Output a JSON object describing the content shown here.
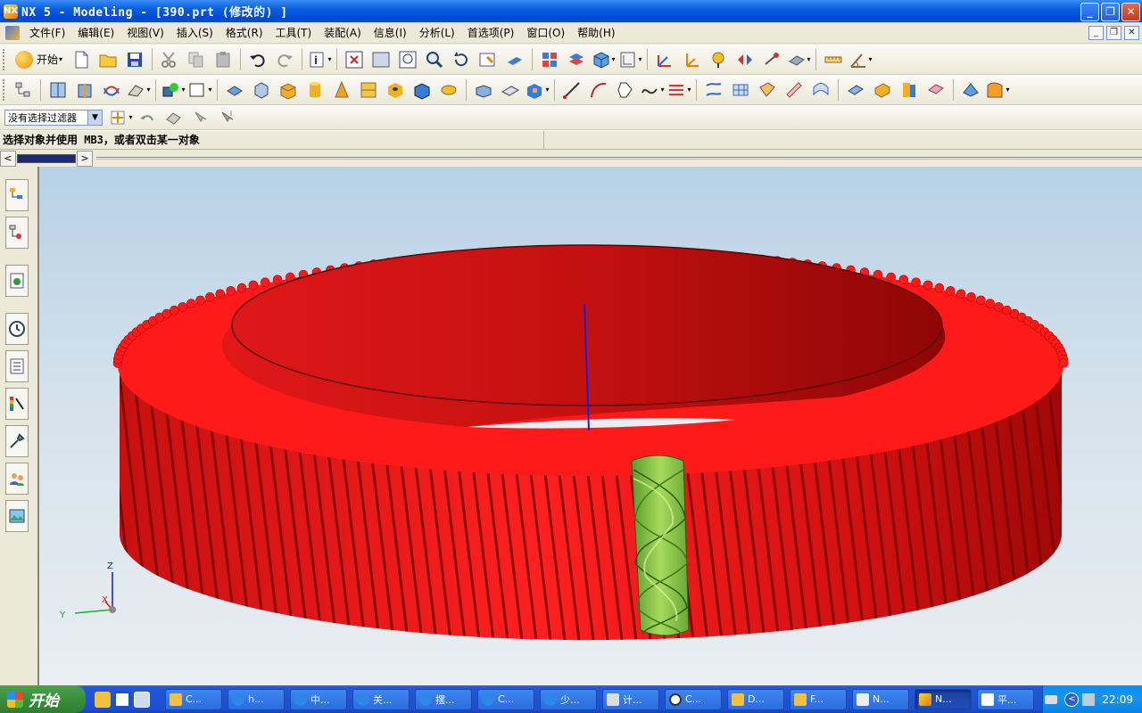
{
  "window": {
    "title": "NX 5 - Modeling - [390.prt  (修改的) ]",
    "icon_letters": "NX"
  },
  "menubar": {
    "items": [
      "文件(F)",
      "编辑(E)",
      "视图(V)",
      "插入(S)",
      "格式(R)",
      "工具(T)",
      "装配(A)",
      "信息(I)",
      "分析(L)",
      "首选项(P)",
      "窗口(O)",
      "帮助(H)"
    ]
  },
  "toolbar": {
    "start_label": "开始"
  },
  "selection": {
    "filter_value": "没有选择过滤器"
  },
  "cue": {
    "text": "选择对象并使用 MB3，或者双击某一对象"
  },
  "viewport": {
    "triad": {
      "z": "Z",
      "x": "X",
      "y": "Y"
    }
  },
  "taskbar": {
    "start_label": "开始",
    "tasks": [
      "C...",
      "h...",
      "中...",
      "关...",
      "摆...",
      "C...",
      "少...",
      "计...",
      "C...",
      "D...",
      "F...",
      "N...",
      "N...",
      "平..."
    ],
    "clock": "22:09"
  },
  "colors": {
    "gear": "#e01010",
    "cutter": "#8cc63c",
    "title_bar": "#0a5fe0",
    "viewport_top": "#b7d1e6",
    "taskbar": "#1c4fd0"
  }
}
